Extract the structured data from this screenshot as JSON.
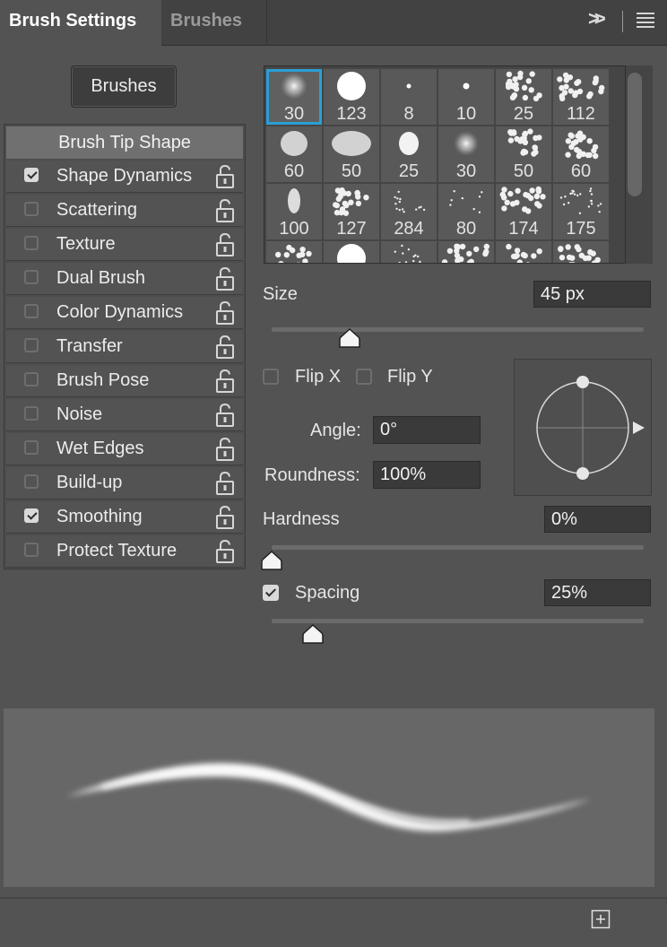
{
  "tabs": {
    "active": "Brush Settings",
    "inactive": "Brushes"
  },
  "brushes_button": "Brushes",
  "options": {
    "header": "Brush Tip Shape",
    "items": [
      {
        "label": "Shape Dynamics",
        "checked": true
      },
      {
        "label": "Scattering",
        "checked": false
      },
      {
        "label": "Texture",
        "checked": false
      },
      {
        "label": "Dual Brush",
        "checked": false
      },
      {
        "label": "Color Dynamics",
        "checked": false
      },
      {
        "label": "Transfer",
        "checked": false
      },
      {
        "label": "Brush Pose",
        "checked": false
      },
      {
        "label": "Noise",
        "checked": false
      },
      {
        "label": "Wet Edges",
        "checked": false
      },
      {
        "label": "Build-up",
        "checked": false
      },
      {
        "label": "Smoothing",
        "checked": true
      },
      {
        "label": "Protect Texture",
        "checked": false
      }
    ]
  },
  "presets": [
    "30",
    "123",
    "8",
    "10",
    "25",
    "112",
    "60",
    "50",
    "25",
    "30",
    "50",
    "60",
    "100",
    "127",
    "284",
    "80",
    "174",
    "175"
  ],
  "size": {
    "label": "Size",
    "value": "45 px",
    "slider": 0.21
  },
  "flip": {
    "x_label": "Flip X",
    "y_label": "Flip Y",
    "x": false,
    "y": false
  },
  "angle": {
    "label": "Angle:",
    "value": "0°"
  },
  "roundness": {
    "label": "Roundness:",
    "value": "100%"
  },
  "hardness": {
    "label": "Hardness",
    "value": "0%",
    "slider": 0.0
  },
  "spacing": {
    "label": "Spacing",
    "value": "25%",
    "checked": true,
    "slider": 0.11
  },
  "colors": {
    "panel": "#535353",
    "selection": "#2a9fd6"
  }
}
